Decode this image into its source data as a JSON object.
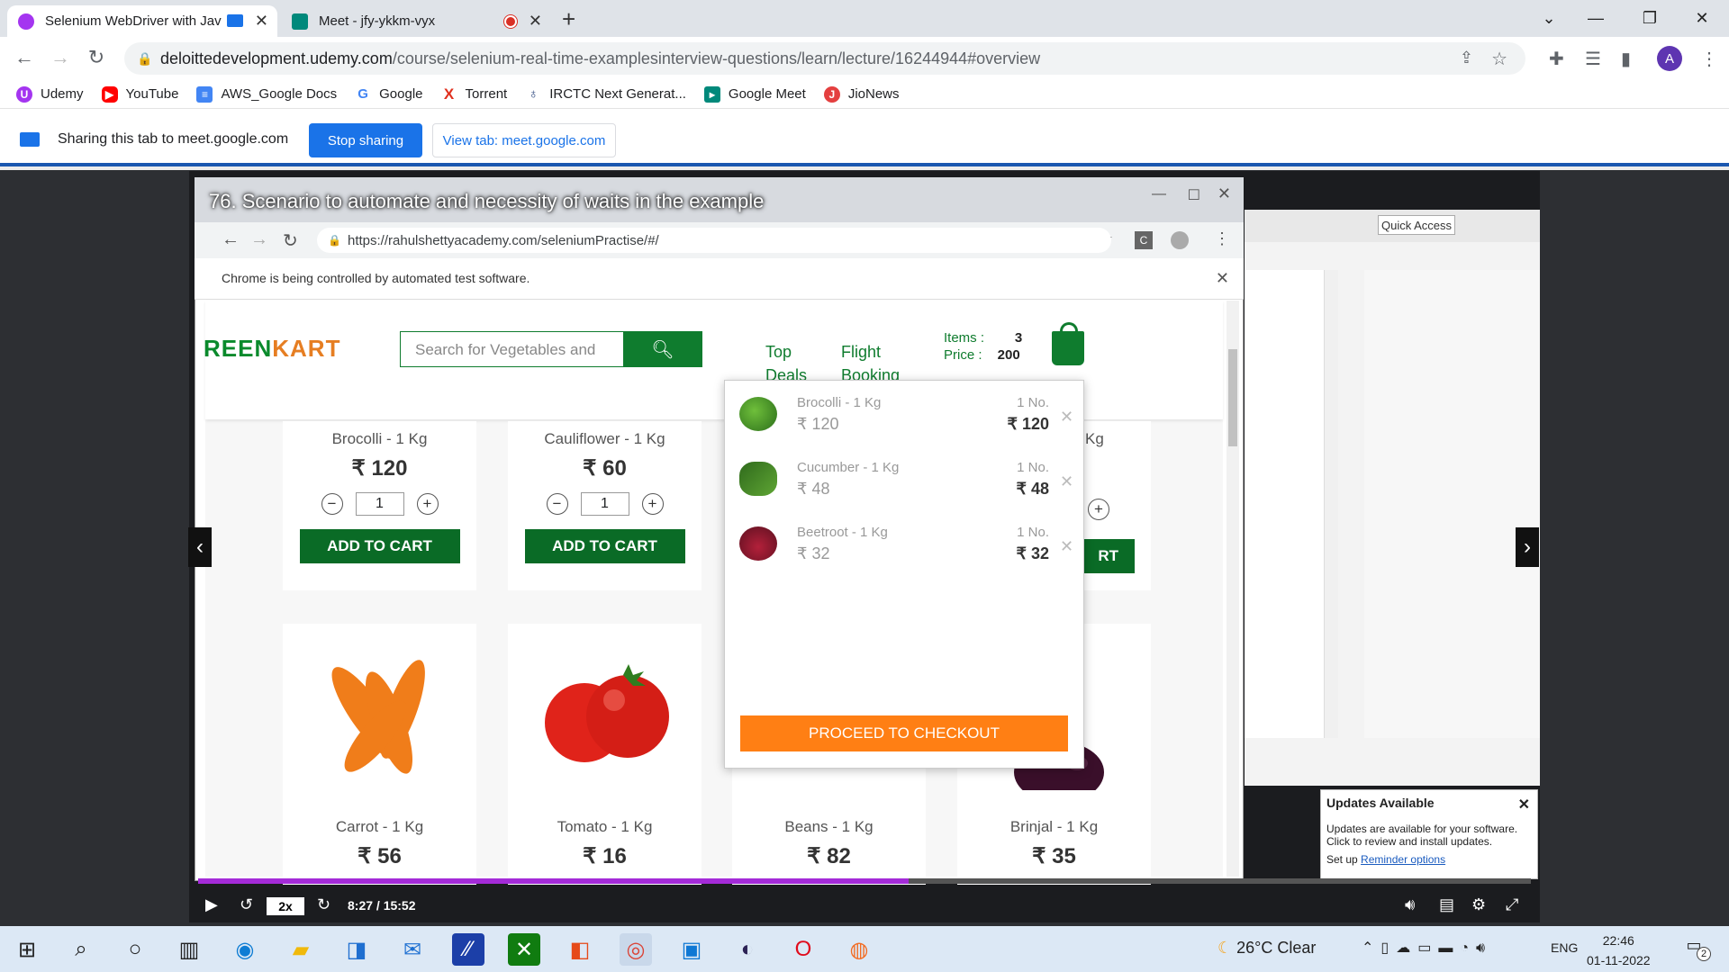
{
  "browser": {
    "tabs": [
      {
        "title": "Selenium WebDriver with Jav",
        "active": true
      },
      {
        "title": "Meet - jfy-ykkm-vyx",
        "active": false
      }
    ],
    "url_domain": "deloittedevelopment.udemy.com",
    "url_path": "/course/selenium-real-time-examplesinterview-questions/learn/lecture/16244944#overview",
    "profile_initial": "A",
    "bookmarks": [
      {
        "label": "Udemy",
        "icon": "udemy-icon",
        "color": "#a435f0"
      },
      {
        "label": "YouTube",
        "icon": "youtube-icon",
        "color": "#ff0000"
      },
      {
        "label": "AWS_Google Docs",
        "icon": "docs-icon",
        "color": "#4285f4"
      },
      {
        "label": "Google",
        "icon": "google-icon",
        "color": "#4285f4"
      },
      {
        "label": "Torrent",
        "icon": "torrent-icon",
        "color": "#e0301e"
      },
      {
        "label": "IRCTC Next Generat...",
        "icon": "irctc-icon",
        "color": "#213d77"
      },
      {
        "label": "Google Meet",
        "icon": "meet-icon",
        "color": "#00897b"
      },
      {
        "label": "JioNews",
        "icon": "jionews-icon",
        "color": "#e43f3f"
      }
    ]
  },
  "sharing": {
    "text": "Sharing this tab to meet.google.com",
    "stop_label": "Stop sharing",
    "view_label": "View tab: meet.google.com"
  },
  "video": {
    "lecture_title": "76. Scenario to automate and necessity of waits in the example",
    "speed": "2x",
    "time": "8:27 / 15:52",
    "progress_fraction": 0.533
  },
  "inner_browser": {
    "url": "https://rahulshettyacademy.com/seleniumPractise/#/",
    "automation_notice": "Chrome is being controlled by automated test software."
  },
  "greenkart": {
    "logo_green": "REEN",
    "logo_orange": "KART",
    "search_placeholder": "Search for Vegetables and",
    "nav": [
      {
        "line1": "Top",
        "line2": "Deals"
      },
      {
        "line1": "Flight",
        "line2": "Booking"
      }
    ],
    "items_label": "Items",
    "items_value": "3",
    "price_label": "Price",
    "price_value": "200",
    "products_row1": [
      {
        "name": "Brocolli - 1 Kg",
        "price": "₹ 120",
        "qty": "1",
        "button": "ADD TO CART"
      },
      {
        "name": "Cauliflower - 1 Kg",
        "price": "₹ 60",
        "qty": "1",
        "button": "ADD TO CART"
      },
      {
        "name": "Kg",
        "price": "",
        "qty": "",
        "button": "RT"
      }
    ],
    "products_row2": [
      {
        "name": "Carrot - 1 Kg",
        "price": "₹ 56"
      },
      {
        "name": "Tomato - 1 Kg",
        "price": "₹ 16"
      },
      {
        "name": "Beans - 1 Kg",
        "price": "₹ 82"
      },
      {
        "name": "Brinjal - 1 Kg",
        "price": "₹ 35"
      }
    ],
    "cart_items": [
      {
        "name": "Brocolli - 1 Kg",
        "price": "₹ 120",
        "qty": "1 No.",
        "total": "₹ 120"
      },
      {
        "name": "Cucumber - 1 Kg",
        "price": "₹ 48",
        "qty": "1 No.",
        "total": "₹ 48"
      },
      {
        "name": "Beetroot - 1 Kg",
        "price": "₹ 32",
        "qty": "1 No.",
        "total": "₹ 32"
      }
    ],
    "checkout_label": "PROCEED TO CHECKOUT"
  },
  "eclipse": {
    "quick_access": "Quick Access",
    "updates_title": "Updates Available",
    "updates_body": "Updates are available for your software. Click to review and install updates.",
    "updates_setup": "Set up",
    "updates_link": "Reminder options"
  },
  "taskbar": {
    "weather": "26°C  Clear",
    "lang": "ENG",
    "time": "22:46",
    "date": "01-11-2022",
    "notifications": "2"
  }
}
